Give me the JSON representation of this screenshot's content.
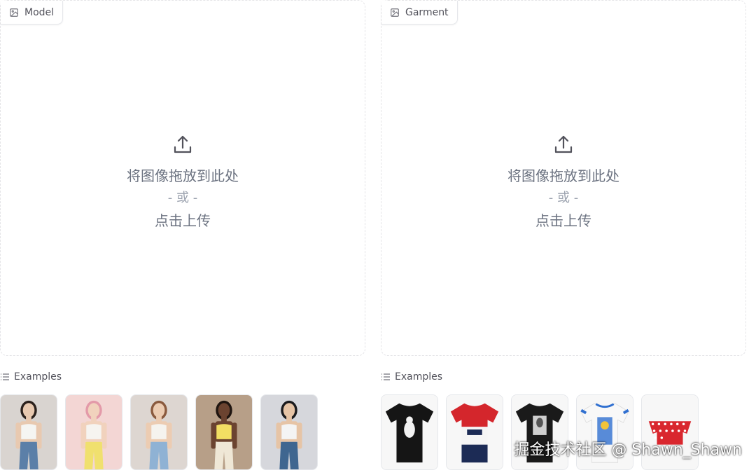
{
  "model_panel": {
    "label": "Model",
    "label_icon": "image-icon",
    "upload_icon": "upload-icon",
    "drop_text": "将图像拖放到此处",
    "or_text": "- 或 -",
    "click_text": "点击上传",
    "examples_label": "Examples",
    "examples_icon": "list-icon",
    "examples": [
      {
        "name": "model-example-1",
        "bg": "#d9d4d0",
        "skin": "#e8c9b0",
        "hair": "#2b211c",
        "top": "#f5f5f2",
        "bottom": "#5b7fa8"
      },
      {
        "name": "model-example-2",
        "bg": "#f3d6d4",
        "skin": "#f1d2bd",
        "hair": "#e39aa9",
        "top": "#f6f4f0",
        "bottom": "#f0e06e"
      },
      {
        "name": "model-example-3",
        "bg": "#ddd6d1",
        "skin": "#ecccb2",
        "hair": "#8a5a3e",
        "top": "#f5f3ee",
        "bottom": "#8fb2d4"
      },
      {
        "name": "model-example-4",
        "bg": "#b79f88",
        "skin": "#6b4330",
        "hair": "#1f1510",
        "top": "#f2de63",
        "bottom": "#efe7d6"
      },
      {
        "name": "model-example-5",
        "bg": "#d6d7dc",
        "skin": "#e6c4a6",
        "hair": "#1b1b1e",
        "top": "#f4f4f4",
        "bottom": "#3f6690"
      }
    ]
  },
  "garment_panel": {
    "label": "Garment",
    "label_icon": "image-icon",
    "upload_icon": "upload-icon",
    "drop_text": "将图像拖放到此处",
    "or_text": "- 或 -",
    "click_text": "点击上传",
    "examples_label": "Examples",
    "examples_icon": "list-icon",
    "examples": [
      {
        "name": "garment-example-1",
        "shirt": "#151515",
        "accent": "#f2f2f2",
        "bg": "#f7f7f7"
      },
      {
        "name": "garment-example-2",
        "shirt": "#f5f5f5",
        "accent": "#d4262c",
        "accent2": "#1c2b55",
        "bg": "#f7f7f7"
      },
      {
        "name": "garment-example-3",
        "shirt": "#1a1a1a",
        "accent": "#cfcfcf",
        "bg": "#f7f7f7"
      },
      {
        "name": "garment-example-4",
        "shirt": "#f8f8f8",
        "accent": "#2f6fd0",
        "accent2": "#f0c33a",
        "bg": "#f7f7f7"
      },
      {
        "name": "garment-example-5",
        "shirt": "#d9272e",
        "accent": "#ffffff",
        "bg": "#f7f7f7"
      }
    ]
  },
  "watermark": "掘金技术社区 @ Shawn_Shawn"
}
